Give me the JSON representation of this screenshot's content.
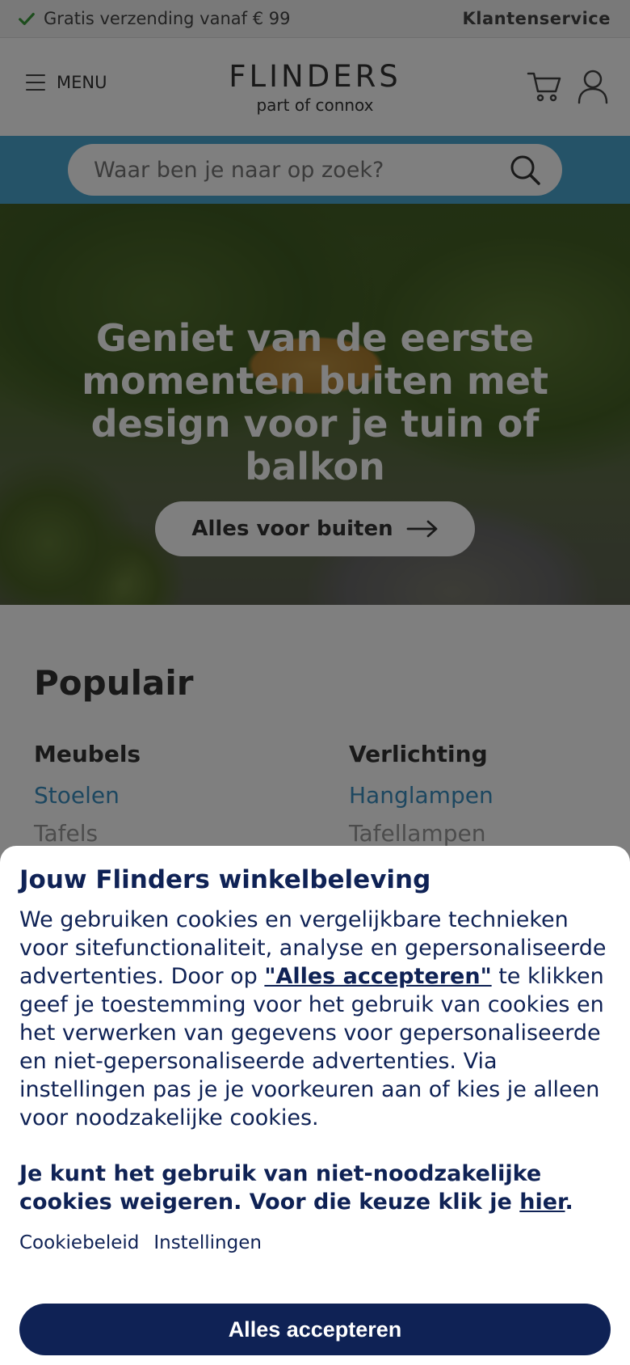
{
  "topbar": {
    "shipping": "Gratis verzending vanaf € 99",
    "service": "Klantenservice"
  },
  "header": {
    "menu_label": "MENU",
    "logo_brand": "FLINDERS",
    "logo_sub": "part of connox"
  },
  "search": {
    "placeholder": "Waar ben je naar op zoek?"
  },
  "hero": {
    "title": "Geniet van de eerste momenten buiten met design voor je tuin of balkon",
    "cta": "Alles voor buiten"
  },
  "popular": {
    "title": "Populair",
    "col1": {
      "heading": "Meubels",
      "link1": "Stoelen",
      "link2": "Tafels"
    },
    "col2": {
      "heading": "Verlichting",
      "link1": "Hanglampen",
      "link2": "Tafellampen"
    }
  },
  "cookie": {
    "title": "Jouw Flinders winkelbeleving",
    "body_part1": "We gebruiken cookies en vergelijkbare technieken voor sitefunctionaliteit, analyse en gepersonaliseerde advertenties. Door op ",
    "body_link": "\"Alles accepteren\"",
    "body_part2": " te klikken geef je toestemming voor het gebruik van cookies en het verwerken van gegevens voor gepersonaliseerde en niet-gepersonaliseerde advertenties. Via instellingen pas je je voorkeuren aan of kies je alleen voor noodzakelijke cookies.",
    "refuse_text": "Je kunt het gebruik van niet-noodzakelijke cookies weigeren. Voor die keuze klik je ",
    "refuse_link": "hier",
    "refuse_end": ".",
    "policy_link": "Cookiebeleid",
    "settings_link": "Instellingen",
    "accept_button": "Alles accepteren"
  },
  "colors": {
    "accent_blue": "#4ba7d1",
    "navy": "#0f2255",
    "link_blue": "#3a8fc0"
  }
}
